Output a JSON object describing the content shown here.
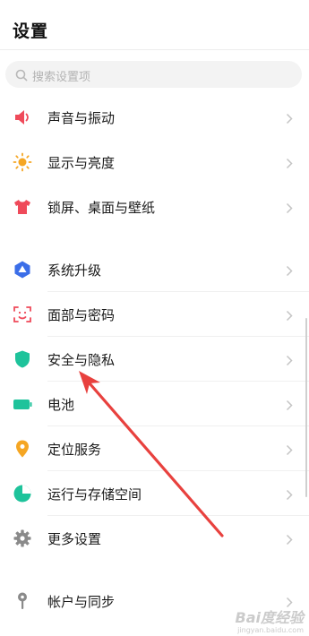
{
  "header": {
    "title": "设置"
  },
  "search": {
    "placeholder": "搜索设置项"
  },
  "items": [
    {
      "label": "声音与振动",
      "icon": "speaker-icon",
      "color": "#ef4a5a"
    },
    {
      "label": "显示与亮度",
      "icon": "sun-icon",
      "color": "#f5a623"
    },
    {
      "label": "锁屏、桌面与壁纸",
      "icon": "shirt-icon",
      "color": "#ef4a5a"
    },
    {
      "label": "系统升级",
      "icon": "upgrade-icon",
      "color": "#3b6ee8"
    },
    {
      "label": "面部与密码",
      "icon": "face-scan-icon",
      "color": "#ef4a5a"
    },
    {
      "label": "安全与隐私",
      "icon": "shield-icon",
      "color": "#1ec39b"
    },
    {
      "label": "电池",
      "icon": "battery-icon",
      "color": "#1ec39b"
    },
    {
      "label": "定位服务",
      "icon": "location-icon",
      "color": "#f5a623"
    },
    {
      "label": "运行与存储空间",
      "icon": "pie-chart-icon",
      "color": "#1ec39b"
    },
    {
      "label": "更多设置",
      "icon": "gear-icon",
      "color": "#8a8a8a"
    },
    {
      "label": "帐户与同步",
      "icon": "key-icon",
      "color": "#8a8a8a"
    }
  ],
  "annotation": {
    "color": "#e8413e"
  },
  "watermark": {
    "text": "Bai度经验",
    "sub": "jingyan.baidu.com"
  }
}
